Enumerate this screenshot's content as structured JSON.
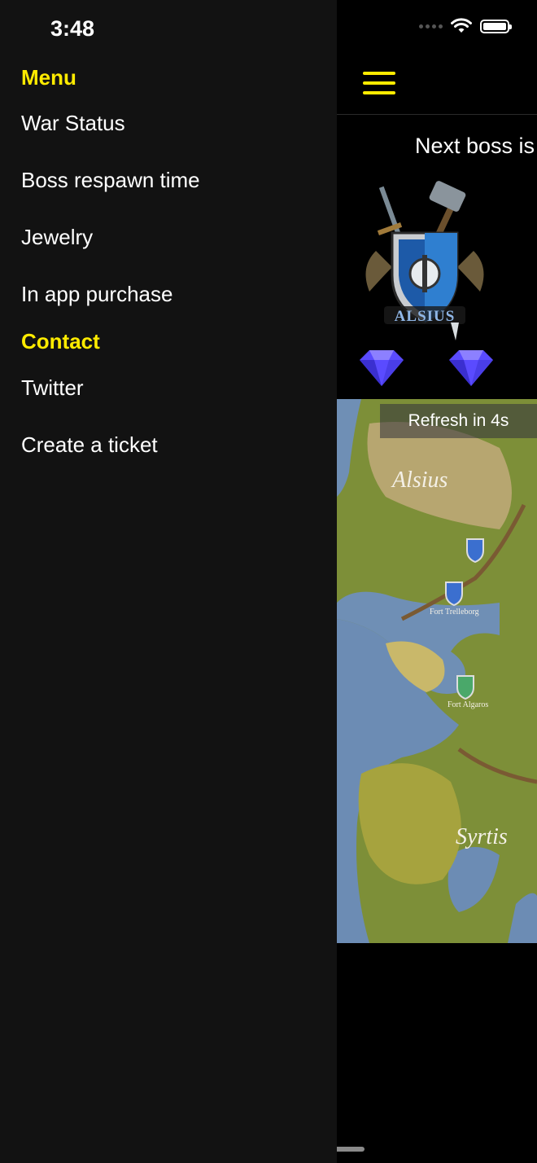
{
  "status_bar": {
    "time": "3:48"
  },
  "header": {
    "menu_icon": "hamburger-icon"
  },
  "main": {
    "boss_title": "Next boss is",
    "crest_label": "ALSIUS",
    "gem_icon": "diamond-icon",
    "refresh_label": "Refresh in 4s",
    "map_labels": {
      "alsius": "Alsius",
      "fort_trelleborg": "Fort Trelleborg",
      "fort_algaros": "Fort Algaros",
      "syrtis": "Syrtis"
    }
  },
  "drawer": {
    "menu_heading": "Menu",
    "menu_items": [
      "War Status",
      "Boss respawn time",
      "Jewelry",
      "In app purchase"
    ],
    "contact_heading": "Contact",
    "contact_items": [
      "Twitter",
      "Create a ticket"
    ]
  },
  "colors": {
    "accent": "#ffeb00",
    "drawer_bg": "#121212",
    "background": "#000000"
  }
}
